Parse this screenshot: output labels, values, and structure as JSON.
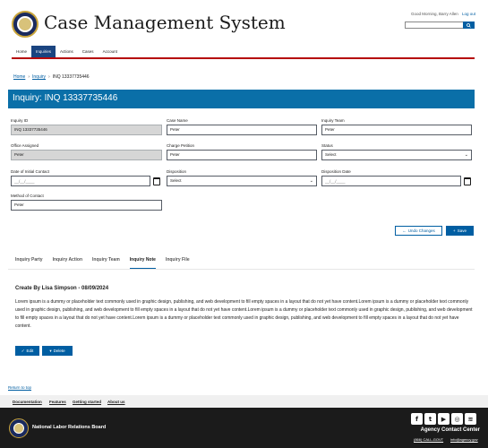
{
  "header": {
    "title": "Case Management System",
    "greeting": "Good Morning, Barry Allen",
    "logout": "Log out",
    "search_placeholder": ""
  },
  "nav": {
    "items": [
      "Home",
      "Inquiries",
      "Actions",
      "Cases",
      "Account"
    ],
    "active": "Inquiries"
  },
  "breadcrumb": {
    "home": "Home",
    "inquiry": "Inquiry",
    "current": "INQ 13337735446"
  },
  "page": {
    "title": "Inquiry: INQ 13337735446"
  },
  "form": {
    "inquiry_id": {
      "label": "Inquiry ID",
      "value": "INQ 13337735446"
    },
    "case_name": {
      "label": "Case Name",
      "value": "Peter"
    },
    "inquiry_team": {
      "label": "Inquiry Team",
      "value": "Peter"
    },
    "office_assigned": {
      "label": "Office Assigned",
      "value": "Peter"
    },
    "charge_petition": {
      "label": "Charge Petition",
      "value": "Peter"
    },
    "status": {
      "label": "Status",
      "value": "Select"
    },
    "date_initial_contact": {
      "label": "Date of Initial Contact",
      "placeholder": "__/__/____"
    },
    "disposition": {
      "label": "Disposition",
      "value": "Select"
    },
    "disposition_date": {
      "label": "Disposition Date",
      "placeholder": "__/__/____"
    },
    "method_of_contact": {
      "label": "Method of Contact",
      "value": "Peter"
    }
  },
  "actions": {
    "undo": "Undo Changes",
    "save": "Save"
  },
  "tabs": {
    "items": [
      "Inquiry Party",
      "Inquiry Action",
      "Inquiry Team",
      "Inquiry Note",
      "Inquiry File"
    ],
    "active": "Inquiry Note"
  },
  "note": {
    "title": "Create By Lisa Simpson - 08/09/2024",
    "body": "Lorem ipsum is a dummy or placeholder text commonly used in graphic design, publishing, and web development to fill empty spaces in a layout that do not yet have content.Lorem ipsum is a dummy or placeholder text commonly used in graphic design, publishing, and web development to fill empty spaces in a layout that do not yet have content.Lorem ipsum is a dummy or placeholder text commonly used in graphic design, publishing, and web development to fill empty spaces in a layout that do not yet have content.Lorem ipsum is a dummy or placeholder text commonly used in graphic design, publishing, and web development to fill empty spaces in a layout that do not yet have content.",
    "edit": "Edit",
    "delete": "Delete"
  },
  "back_to_top": "Return to top",
  "footer_links": [
    "Documentation",
    "Features",
    "Getting started",
    "About us"
  ],
  "footer": {
    "agency": "National Labor Relations Board",
    "contact_title": "Agency Contact Center",
    "phone": "(866) CALL-GOVT",
    "email": "info@agency.gov"
  },
  "colors": {
    "primary": "#005ea2",
    "banner": "#0a6fa8",
    "nav_active": "#1a4480",
    "accent_rule": "#b50909",
    "footer": "#1b1b1b"
  }
}
